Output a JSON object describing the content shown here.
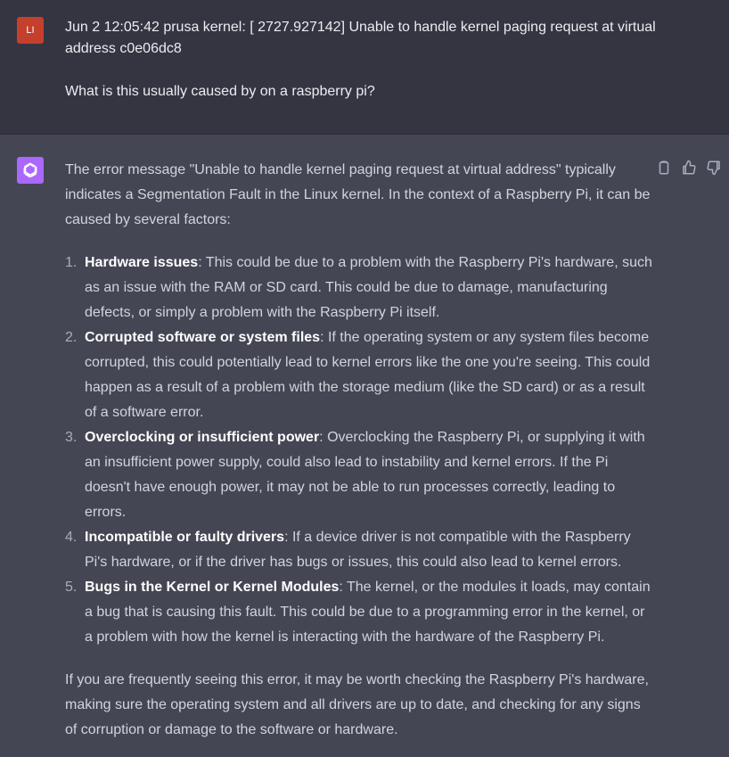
{
  "user": {
    "avatar_initials": "LI",
    "avatar_color": "#c4402d",
    "line1": "Jun  2 12:05:42 prusa kernel: [ 2727.927142] Unable to handle kernel paging request at virtual address c0e06dc8",
    "line2": "What is this usually caused by on a raspberry pi?"
  },
  "assistant": {
    "avatar_icon": "openai-logo-icon",
    "avatar_color": "#ab68ff",
    "intro": "The error message \"Unable to handle kernel paging request at virtual address\" typically indicates a Segmentation Fault in the Linux kernel. In the context of a Raspberry Pi, it can be caused by several factors:",
    "items": [
      {
        "num": "1.",
        "title": "Hardware issues",
        "text": ": This could be due to a problem with the Raspberry Pi's hardware, such as an issue with the RAM or SD card. This could be due to damage, manufacturing defects, or simply a problem with the Raspberry Pi itself."
      },
      {
        "num": "2.",
        "title": "Corrupted software or system files",
        "text": ": If the operating system or any system files become corrupted, this could potentially lead to kernel errors like the one you're seeing. This could happen as a result of a problem with the storage medium (like the SD card) or as a result of a software error."
      },
      {
        "num": "3.",
        "title": "Overclocking or insufficient power",
        "text": ": Overclocking the Raspberry Pi, or supplying it with an insufficient power supply, could also lead to instability and kernel errors. If the Pi doesn't have enough power, it may not be able to run processes correctly, leading to errors."
      },
      {
        "num": "4.",
        "title": "Incompatible or faulty drivers",
        "text": ": If a device driver is not compatible with the Raspberry Pi's hardware, or if the driver has bugs or issues, this could also lead to kernel errors."
      },
      {
        "num": "5.",
        "title": "Bugs in the Kernel or Kernel Modules",
        "text": ": The kernel, or the modules it loads, may contain a bug that is causing this fault. This could be due to a programming error in the kernel, or a problem with how the kernel is interacting with the hardware of the Raspberry Pi."
      }
    ],
    "outro": "If you are frequently seeing this error, it may be worth checking the Raspberry Pi's hardware, making sure the operating system and all drivers are up to date, and checking for any signs of corruption or damage to the software or hardware."
  },
  "actions": [
    "copy-icon",
    "thumbs-up-icon",
    "thumbs-down-icon"
  ]
}
